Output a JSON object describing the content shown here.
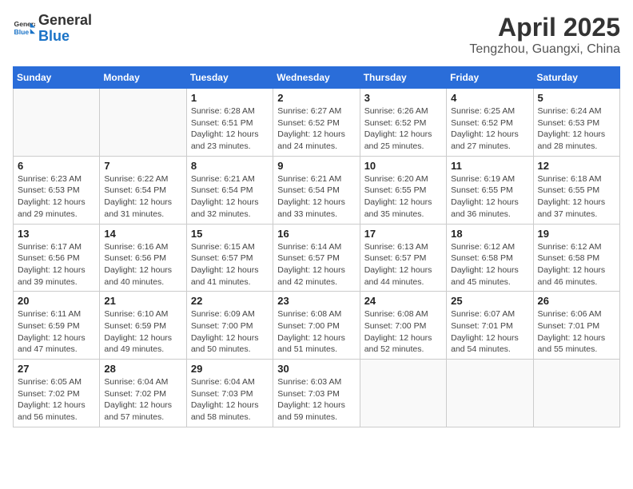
{
  "header": {
    "logo_line1": "General",
    "logo_line2": "Blue",
    "month": "April 2025",
    "location": "Tengzhou, Guangxi, China"
  },
  "weekdays": [
    "Sunday",
    "Monday",
    "Tuesday",
    "Wednesday",
    "Thursday",
    "Friday",
    "Saturday"
  ],
  "weeks": [
    [
      {
        "day": "",
        "info": ""
      },
      {
        "day": "",
        "info": ""
      },
      {
        "day": "1",
        "info": "Sunrise: 6:28 AM\nSunset: 6:51 PM\nDaylight: 12 hours and 23 minutes."
      },
      {
        "day": "2",
        "info": "Sunrise: 6:27 AM\nSunset: 6:52 PM\nDaylight: 12 hours and 24 minutes."
      },
      {
        "day": "3",
        "info": "Sunrise: 6:26 AM\nSunset: 6:52 PM\nDaylight: 12 hours and 25 minutes."
      },
      {
        "day": "4",
        "info": "Sunrise: 6:25 AM\nSunset: 6:52 PM\nDaylight: 12 hours and 27 minutes."
      },
      {
        "day": "5",
        "info": "Sunrise: 6:24 AM\nSunset: 6:53 PM\nDaylight: 12 hours and 28 minutes."
      }
    ],
    [
      {
        "day": "6",
        "info": "Sunrise: 6:23 AM\nSunset: 6:53 PM\nDaylight: 12 hours and 29 minutes."
      },
      {
        "day": "7",
        "info": "Sunrise: 6:22 AM\nSunset: 6:54 PM\nDaylight: 12 hours and 31 minutes."
      },
      {
        "day": "8",
        "info": "Sunrise: 6:21 AM\nSunset: 6:54 PM\nDaylight: 12 hours and 32 minutes."
      },
      {
        "day": "9",
        "info": "Sunrise: 6:21 AM\nSunset: 6:54 PM\nDaylight: 12 hours and 33 minutes."
      },
      {
        "day": "10",
        "info": "Sunrise: 6:20 AM\nSunset: 6:55 PM\nDaylight: 12 hours and 35 minutes."
      },
      {
        "day": "11",
        "info": "Sunrise: 6:19 AM\nSunset: 6:55 PM\nDaylight: 12 hours and 36 minutes."
      },
      {
        "day": "12",
        "info": "Sunrise: 6:18 AM\nSunset: 6:55 PM\nDaylight: 12 hours and 37 minutes."
      }
    ],
    [
      {
        "day": "13",
        "info": "Sunrise: 6:17 AM\nSunset: 6:56 PM\nDaylight: 12 hours and 39 minutes."
      },
      {
        "day": "14",
        "info": "Sunrise: 6:16 AM\nSunset: 6:56 PM\nDaylight: 12 hours and 40 minutes."
      },
      {
        "day": "15",
        "info": "Sunrise: 6:15 AM\nSunset: 6:57 PM\nDaylight: 12 hours and 41 minutes."
      },
      {
        "day": "16",
        "info": "Sunrise: 6:14 AM\nSunset: 6:57 PM\nDaylight: 12 hours and 42 minutes."
      },
      {
        "day": "17",
        "info": "Sunrise: 6:13 AM\nSunset: 6:57 PM\nDaylight: 12 hours and 44 minutes."
      },
      {
        "day": "18",
        "info": "Sunrise: 6:12 AM\nSunset: 6:58 PM\nDaylight: 12 hours and 45 minutes."
      },
      {
        "day": "19",
        "info": "Sunrise: 6:12 AM\nSunset: 6:58 PM\nDaylight: 12 hours and 46 minutes."
      }
    ],
    [
      {
        "day": "20",
        "info": "Sunrise: 6:11 AM\nSunset: 6:59 PM\nDaylight: 12 hours and 47 minutes."
      },
      {
        "day": "21",
        "info": "Sunrise: 6:10 AM\nSunset: 6:59 PM\nDaylight: 12 hours and 49 minutes."
      },
      {
        "day": "22",
        "info": "Sunrise: 6:09 AM\nSunset: 7:00 PM\nDaylight: 12 hours and 50 minutes."
      },
      {
        "day": "23",
        "info": "Sunrise: 6:08 AM\nSunset: 7:00 PM\nDaylight: 12 hours and 51 minutes."
      },
      {
        "day": "24",
        "info": "Sunrise: 6:08 AM\nSunset: 7:00 PM\nDaylight: 12 hours and 52 minutes."
      },
      {
        "day": "25",
        "info": "Sunrise: 6:07 AM\nSunset: 7:01 PM\nDaylight: 12 hours and 54 minutes."
      },
      {
        "day": "26",
        "info": "Sunrise: 6:06 AM\nSunset: 7:01 PM\nDaylight: 12 hours and 55 minutes."
      }
    ],
    [
      {
        "day": "27",
        "info": "Sunrise: 6:05 AM\nSunset: 7:02 PM\nDaylight: 12 hours and 56 minutes."
      },
      {
        "day": "28",
        "info": "Sunrise: 6:04 AM\nSunset: 7:02 PM\nDaylight: 12 hours and 57 minutes."
      },
      {
        "day": "29",
        "info": "Sunrise: 6:04 AM\nSunset: 7:03 PM\nDaylight: 12 hours and 58 minutes."
      },
      {
        "day": "30",
        "info": "Sunrise: 6:03 AM\nSunset: 7:03 PM\nDaylight: 12 hours and 59 minutes."
      },
      {
        "day": "",
        "info": ""
      },
      {
        "day": "",
        "info": ""
      },
      {
        "day": "",
        "info": ""
      }
    ]
  ]
}
